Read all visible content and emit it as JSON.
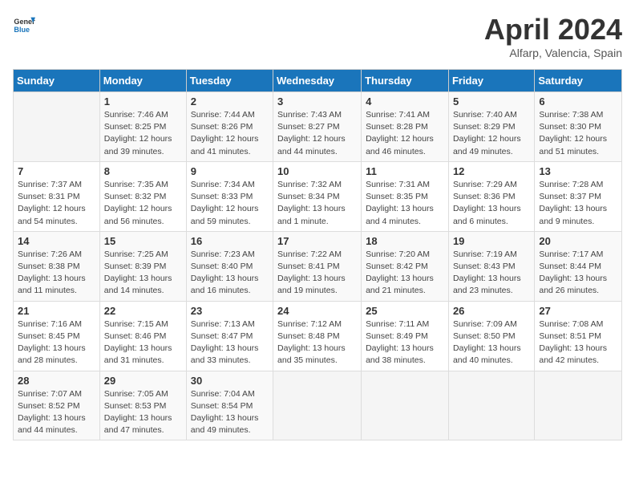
{
  "header": {
    "logo_line1": "General",
    "logo_line2": "Blue",
    "title": "April 2024",
    "subtitle": "Alfarp, Valencia, Spain"
  },
  "days_of_week": [
    "Sunday",
    "Monday",
    "Tuesday",
    "Wednesday",
    "Thursday",
    "Friday",
    "Saturday"
  ],
  "weeks": [
    [
      {
        "day": "",
        "sunrise": "",
        "sunset": "",
        "daylight": ""
      },
      {
        "day": "1",
        "sunrise": "7:46 AM",
        "sunset": "8:25 PM",
        "daylight": "12 hours and 39 minutes."
      },
      {
        "day": "2",
        "sunrise": "7:44 AM",
        "sunset": "8:26 PM",
        "daylight": "12 hours and 41 minutes."
      },
      {
        "day": "3",
        "sunrise": "7:43 AM",
        "sunset": "8:27 PM",
        "daylight": "12 hours and 44 minutes."
      },
      {
        "day": "4",
        "sunrise": "7:41 AM",
        "sunset": "8:28 PM",
        "daylight": "12 hours and 46 minutes."
      },
      {
        "day": "5",
        "sunrise": "7:40 AM",
        "sunset": "8:29 PM",
        "daylight": "12 hours and 49 minutes."
      },
      {
        "day": "6",
        "sunrise": "7:38 AM",
        "sunset": "8:30 PM",
        "daylight": "12 hours and 51 minutes."
      }
    ],
    [
      {
        "day": "7",
        "sunrise": "7:37 AM",
        "sunset": "8:31 PM",
        "daylight": "12 hours and 54 minutes."
      },
      {
        "day": "8",
        "sunrise": "7:35 AM",
        "sunset": "8:32 PM",
        "daylight": "12 hours and 56 minutes."
      },
      {
        "day": "9",
        "sunrise": "7:34 AM",
        "sunset": "8:33 PM",
        "daylight": "12 hours and 59 minutes."
      },
      {
        "day": "10",
        "sunrise": "7:32 AM",
        "sunset": "8:34 PM",
        "daylight": "13 hours and 1 minute."
      },
      {
        "day": "11",
        "sunrise": "7:31 AM",
        "sunset": "8:35 PM",
        "daylight": "13 hours and 4 minutes."
      },
      {
        "day": "12",
        "sunrise": "7:29 AM",
        "sunset": "8:36 PM",
        "daylight": "13 hours and 6 minutes."
      },
      {
        "day": "13",
        "sunrise": "7:28 AM",
        "sunset": "8:37 PM",
        "daylight": "13 hours and 9 minutes."
      }
    ],
    [
      {
        "day": "14",
        "sunrise": "7:26 AM",
        "sunset": "8:38 PM",
        "daylight": "13 hours and 11 minutes."
      },
      {
        "day": "15",
        "sunrise": "7:25 AM",
        "sunset": "8:39 PM",
        "daylight": "13 hours and 14 minutes."
      },
      {
        "day": "16",
        "sunrise": "7:23 AM",
        "sunset": "8:40 PM",
        "daylight": "13 hours and 16 minutes."
      },
      {
        "day": "17",
        "sunrise": "7:22 AM",
        "sunset": "8:41 PM",
        "daylight": "13 hours and 19 minutes."
      },
      {
        "day": "18",
        "sunrise": "7:20 AM",
        "sunset": "8:42 PM",
        "daylight": "13 hours and 21 minutes."
      },
      {
        "day": "19",
        "sunrise": "7:19 AM",
        "sunset": "8:43 PM",
        "daylight": "13 hours and 23 minutes."
      },
      {
        "day": "20",
        "sunrise": "7:17 AM",
        "sunset": "8:44 PM",
        "daylight": "13 hours and 26 minutes."
      }
    ],
    [
      {
        "day": "21",
        "sunrise": "7:16 AM",
        "sunset": "8:45 PM",
        "daylight": "13 hours and 28 minutes."
      },
      {
        "day": "22",
        "sunrise": "7:15 AM",
        "sunset": "8:46 PM",
        "daylight": "13 hours and 31 minutes."
      },
      {
        "day": "23",
        "sunrise": "7:13 AM",
        "sunset": "8:47 PM",
        "daylight": "13 hours and 33 minutes."
      },
      {
        "day": "24",
        "sunrise": "7:12 AM",
        "sunset": "8:48 PM",
        "daylight": "13 hours and 35 minutes."
      },
      {
        "day": "25",
        "sunrise": "7:11 AM",
        "sunset": "8:49 PM",
        "daylight": "13 hours and 38 minutes."
      },
      {
        "day": "26",
        "sunrise": "7:09 AM",
        "sunset": "8:50 PM",
        "daylight": "13 hours and 40 minutes."
      },
      {
        "day": "27",
        "sunrise": "7:08 AM",
        "sunset": "8:51 PM",
        "daylight": "13 hours and 42 minutes."
      }
    ],
    [
      {
        "day": "28",
        "sunrise": "7:07 AM",
        "sunset": "8:52 PM",
        "daylight": "13 hours and 44 minutes."
      },
      {
        "day": "29",
        "sunrise": "7:05 AM",
        "sunset": "8:53 PM",
        "daylight": "13 hours and 47 minutes."
      },
      {
        "day": "30",
        "sunrise": "7:04 AM",
        "sunset": "8:54 PM",
        "daylight": "13 hours and 49 minutes."
      },
      {
        "day": "",
        "sunrise": "",
        "sunset": "",
        "daylight": ""
      },
      {
        "day": "",
        "sunrise": "",
        "sunset": "",
        "daylight": ""
      },
      {
        "day": "",
        "sunrise": "",
        "sunset": "",
        "daylight": ""
      },
      {
        "day": "",
        "sunrise": "",
        "sunset": "",
        "daylight": ""
      }
    ]
  ],
  "labels": {
    "sunrise": "Sunrise:",
    "sunset": "Sunset:",
    "daylight": "Daylight:"
  }
}
